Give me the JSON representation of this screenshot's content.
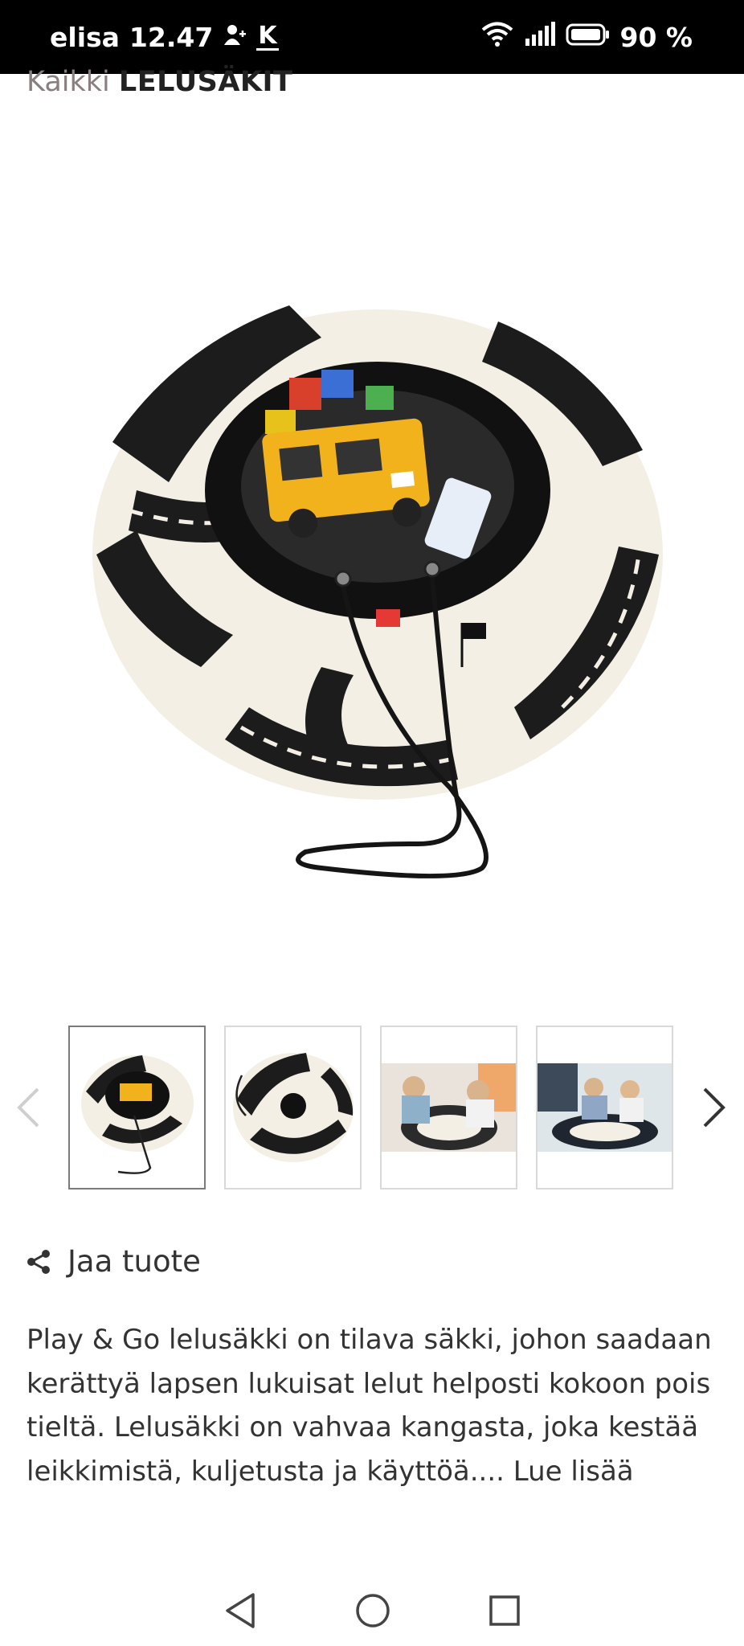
{
  "status_bar": {
    "carrier": "elisa",
    "time": "12.47",
    "k_icon_label": "K",
    "battery": "90 %"
  },
  "breadcrumb": {
    "prefix": "Kaikki",
    "category": "LELUSÄKIT"
  },
  "gallery": {
    "thumbnail_count": 4,
    "active_index": 0
  },
  "share": {
    "label": "Jaa tuote"
  },
  "description": {
    "text": "Play & Go lelusäkki on tilava säkki, johon saadaan kerättyä lapsen lukuisat lelut helposti kokoon pois tieltä. Lelusäkki on vahvaa kangasta, joka kestää leikkimistä, kuljetusta ja käyttöä....",
    "read_more": "Lue lisää"
  },
  "colors": {
    "status_bar_bg": "#000000",
    "text": "#333333",
    "crumb_prefix": "#8a7f80",
    "bag_black": "#1c1c1c",
    "bag_cream": "#f3efe4",
    "van_yellow": "#f2b21b"
  }
}
